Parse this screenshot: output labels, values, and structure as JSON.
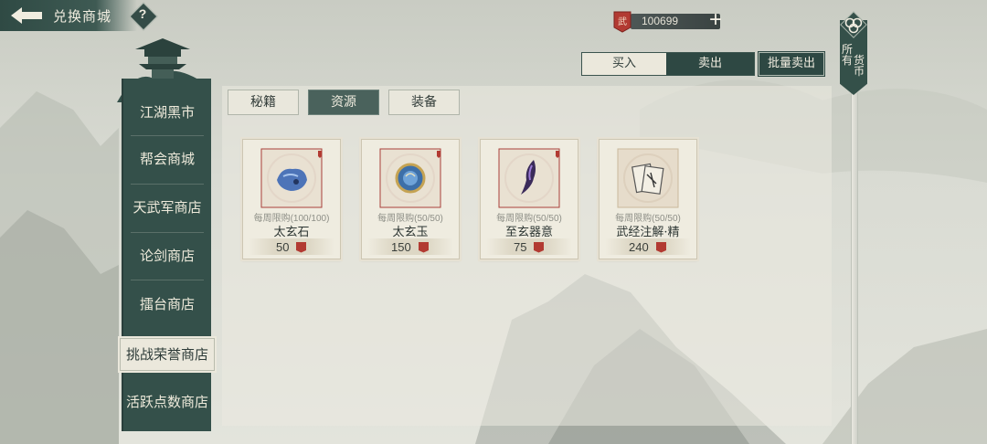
{
  "header": {
    "title": "兑换商城",
    "help_label": "?"
  },
  "currency": {
    "icon_glyph": "武",
    "value": "100699",
    "plus_label": "+"
  },
  "trade_toggle": {
    "buy_label": "买入",
    "sell_label": "卖出",
    "selected": "卖出"
  },
  "bulk_sell_label": "批量卖出",
  "currency_ribbon": {
    "chars": [
      "所有",
      "货币"
    ]
  },
  "sidebar": {
    "items": [
      {
        "label": "江湖黑市"
      },
      {
        "label": "帮会商城"
      },
      {
        "label": "天武军商店"
      },
      {
        "label": "论剑商店"
      },
      {
        "label": "擂台商店"
      },
      {
        "label": "挑战荣誉商店",
        "active": true
      },
      {
        "label": "活跃点数商店"
      }
    ]
  },
  "tabs": [
    {
      "label": "秘籍"
    },
    {
      "label": "资源",
      "active": true
    },
    {
      "label": "装备"
    }
  ],
  "items": [
    {
      "name": "太玄石",
      "limit": "每周限购(100/100)",
      "price": "50",
      "icon": "blue-stone-icon"
    },
    {
      "name": "太玄玉",
      "limit": "每周限购(50/50)",
      "price": "150",
      "icon": "jade-orb-icon"
    },
    {
      "name": "至玄器意",
      "limit": "每周限购(50/50)",
      "price": "75",
      "icon": "dark-crystal-icon"
    },
    {
      "name": "武经注解·精",
      "limit": "每周限购(50/50)",
      "price": "240",
      "icon": "scroll-cards-icon"
    }
  ],
  "colors": {
    "accent_dark": "#34504a",
    "paper": "#efece0",
    "seal_red": "#b23a32"
  }
}
